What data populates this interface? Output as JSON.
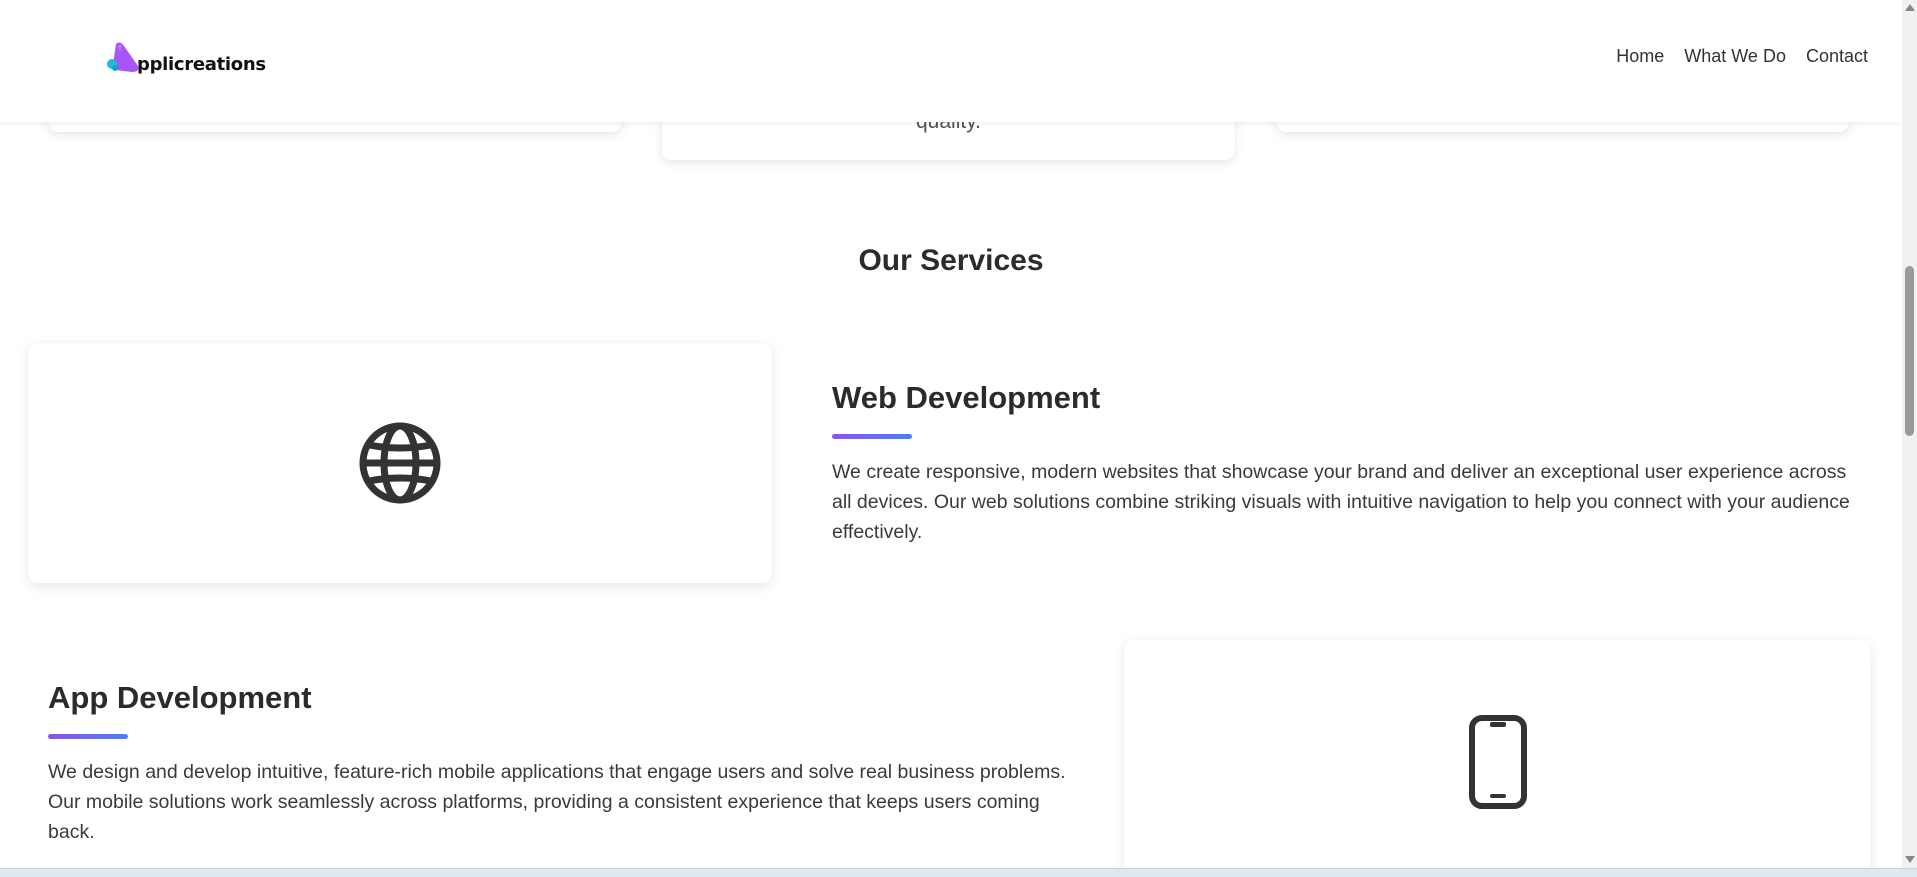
{
  "header": {
    "logo_text": "pplicreations",
    "nav": [
      "Home",
      "What We Do",
      "Contact"
    ]
  },
  "top_cards": {
    "mid_tail_text": "quality."
  },
  "services": {
    "title": "Our Services",
    "items": [
      {
        "title": "Web Development",
        "icon": "globe-icon",
        "description": "We create responsive, modern websites that showcase your brand and deliver an exceptional user experience across all devices. Our web solutions combine striking visuals with intuitive navigation to help you connect with your audience effectively."
      },
      {
        "title": "App Development",
        "icon": "smartphone-icon",
        "description": "We design and develop intuitive, feature-rich mobile applications that engage users and solve real business problems. Our mobile solutions work seamlessly across platforms, providing a consistent experience that keeps users coming back."
      }
    ]
  },
  "colors": {
    "accent_start": "#8b55e8",
    "accent_end": "#4f80f0",
    "logo_purple": "#a855f7",
    "logo_cyan": "#22b8e0",
    "text_dark": "#2b2b2b"
  }
}
